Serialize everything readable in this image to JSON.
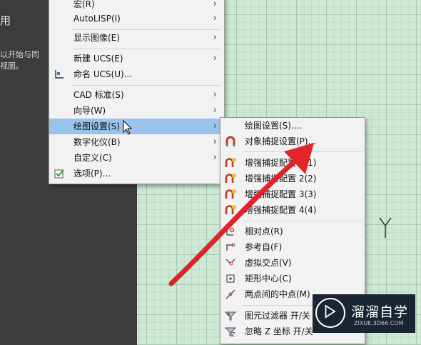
{
  "left_panel": {
    "title": "用",
    "lines": [
      "以开始与同",
      "视图。"
    ]
  },
  "main_menu": {
    "items": [
      {
        "label": "宏(R)",
        "arrow": "›"
      },
      {
        "label": "AutoLISP(I)",
        "arrow": "›"
      },
      {
        "label": "显示图像(E)",
        "arrow": "›"
      },
      {
        "label": "新建 UCS(E)",
        "arrow": "›"
      },
      {
        "label": "命名 UCS(U)...",
        "arrow": ""
      },
      {
        "label": "CAD 标准(S)",
        "arrow": "›"
      },
      {
        "label": "向导(W)",
        "arrow": "›"
      },
      {
        "label": "绘图设置(S)",
        "arrow": "›"
      },
      {
        "label": "数字化仪(B)",
        "arrow": "›"
      },
      {
        "label": "自定义(C)",
        "arrow": "›"
      },
      {
        "label": "选项(P)...",
        "arrow": ""
      }
    ]
  },
  "sub_menu": {
    "items": [
      {
        "label": "绘图设置(S)...."
      },
      {
        "label": "对象捕捉设置(P)..."
      },
      {
        "label": "增强捕捉配置 1(1)"
      },
      {
        "label": "增强捕捉配置 2(2)"
      },
      {
        "label": "增强捕捉配置 3(3)"
      },
      {
        "label": "增强捕捉配置 4(4)"
      },
      {
        "label": "相对点(R)"
      },
      {
        "label": "参考自(F)"
      },
      {
        "label": "虚拟交点(V)"
      },
      {
        "label": "矩形中心(C)"
      },
      {
        "label": "两点间的中点(M)"
      },
      {
        "label": "图元过滤器 开/关"
      },
      {
        "label": "忽略 Z 坐标 开/关"
      }
    ]
  },
  "canvas": {
    "axis_label": "Y"
  },
  "logo": {
    "name": "溜溜自学",
    "url": "ZIXUE.3D66.COM"
  },
  "colors": {
    "highlight": "#9ac3ec",
    "arrow": "#e0262b",
    "grid": "#cde9d6"
  }
}
